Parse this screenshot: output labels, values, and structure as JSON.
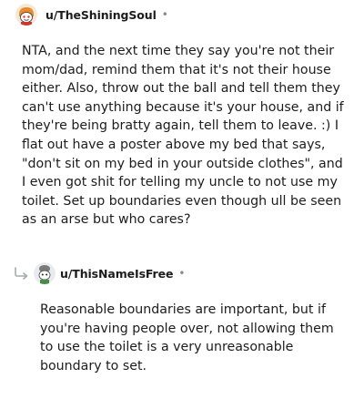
{
  "comments": [
    {
      "username": "u/TheShiningSoul",
      "separator": "•",
      "avatar_icon": "snoo-avatar-icon",
      "body": "NTA, and the next time they say you're not their mom/dad, remind them that it's not their house either. Also, throw out the ball and tell them they can't use anything because it's your house, and if they're being bratty again, tell them to leave. :) I flat out have a poster above my bed that says, \"don't sit on my bed in your outside clothes\", and I even got shit for telling my uncle to not use my toilet. Set up boundaries even though ull be seen as an arse but who cares?"
    },
    {
      "username": "u/ThisNameIsFree",
      "separator": "•",
      "avatar_icon": "snoo-avatar-icon",
      "reply_icon": "reply-arrow-icon",
      "body": "Reasonable boundaries are important, but if you're having people over, not allowing them to use the toilet is a very unreasonable boundary to set."
    }
  ]
}
